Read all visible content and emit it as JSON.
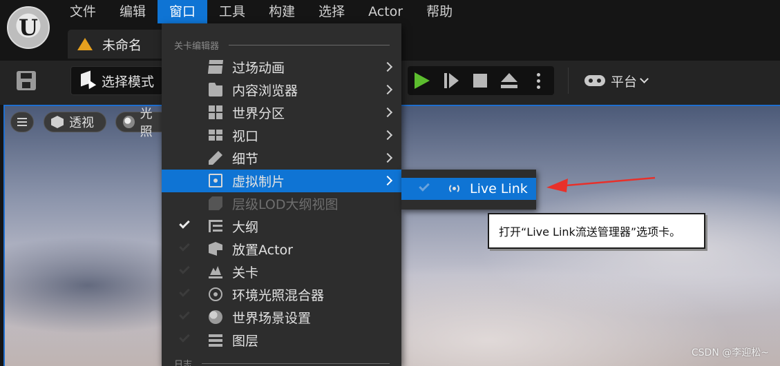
{
  "menubar": {
    "items": [
      "文件",
      "编辑",
      "窗口",
      "工具",
      "构建",
      "选择",
      "Actor",
      "帮助"
    ],
    "active_index": 2
  },
  "doc_tab": {
    "label": "未命名",
    "icon": "level-icon"
  },
  "toolbar": {
    "mode_label": "选择模式",
    "platform_label": "平台",
    "play_icons": [
      "play-icon",
      "skip-frame-icon",
      "stop-icon",
      "eject-icon",
      "more-icon"
    ]
  },
  "viewport": {
    "perspective_label": "透视",
    "lighting_label": "光照"
  },
  "window_menu": {
    "section_title": "关卡编辑器",
    "items": [
      {
        "label": "过场动画",
        "icon": "clapboard-icon",
        "submenu": true,
        "checked": false,
        "enabled": true
      },
      {
        "label": "内容浏览器",
        "icon": "folder-icon",
        "submenu": true,
        "checked": false,
        "enabled": true
      },
      {
        "label": "世界分区",
        "icon": "grid-icon",
        "submenu": true,
        "checked": false,
        "enabled": true
      },
      {
        "label": "视口",
        "icon": "viewport-icon",
        "submenu": true,
        "checked": false,
        "enabled": true
      },
      {
        "label": "细节",
        "icon": "pencil-icon",
        "submenu": true,
        "checked": false,
        "enabled": true
      },
      {
        "label": "虚拟制片",
        "icon": "virtual-production-icon",
        "submenu": true,
        "checked": false,
        "enabled": true,
        "highlighted": true
      },
      {
        "label": "层级LOD大纲视图",
        "icon": "hlod-icon",
        "submenu": false,
        "checked": false,
        "enabled": false
      },
      {
        "label": "大纲",
        "icon": "outliner-icon",
        "submenu": false,
        "checked": true,
        "enabled": true
      },
      {
        "label": "放置Actor",
        "icon": "place-actor-icon",
        "submenu": false,
        "checked": false,
        "enabled": true
      },
      {
        "label": "关卡",
        "icon": "level-icon",
        "submenu": false,
        "checked": false,
        "enabled": true
      },
      {
        "label": "环境光照混合器",
        "icon": "light-mixer-icon",
        "submenu": false,
        "checked": false,
        "enabled": true
      },
      {
        "label": "世界场景设置",
        "icon": "globe-icon",
        "submenu": false,
        "checked": false,
        "enabled": true
      },
      {
        "label": "图层",
        "icon": "layers-icon",
        "submenu": false,
        "checked": false,
        "enabled": true
      }
    ],
    "next_section_title": "日志"
  },
  "submenu": {
    "item_label": "Live Link",
    "icon": "broadcast-icon"
  },
  "tooltip": {
    "text": "打开“Live Link流送管理器”选项卡。"
  },
  "annotation": {
    "arrow_color": "#e8302a"
  },
  "watermark": "CSDN @李迎松~",
  "colors": {
    "highlight": "#0f74d4",
    "play_green": "#5cbd2e",
    "menu_bg": "#2d2d2d"
  }
}
